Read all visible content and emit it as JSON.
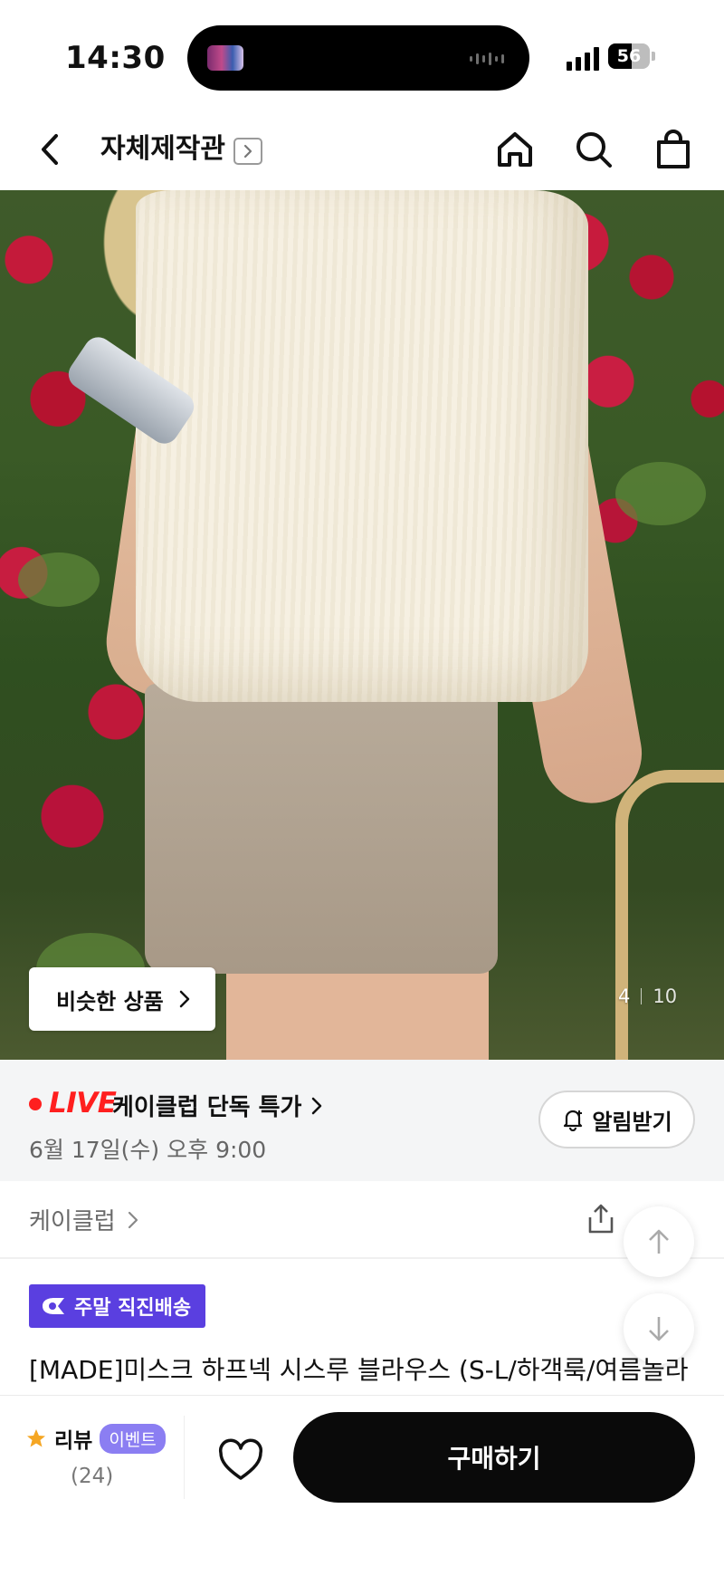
{
  "status_bar": {
    "time": "14:30",
    "battery_percent": "56",
    "battery_level": 0.56,
    "icons": [
      "signal-icon",
      "battery-icon"
    ]
  },
  "nav": {
    "title": "자체제작관",
    "icons": [
      "back-icon",
      "title-chevron-icon",
      "home-icon",
      "search-icon",
      "cart-icon"
    ]
  },
  "hero": {
    "similar_button_label": "비슷한 상품",
    "counter_current": "4",
    "counter_total": "10"
  },
  "live": {
    "tag": "LIVE",
    "title": "케이클럽 단독 특가",
    "date": "6월 17일(수) 오후 9:00",
    "alarm_label": "알림받기",
    "accent_color": "#ff1f1f"
  },
  "brand": {
    "name": "케이클럽",
    "icons": [
      "share-icon"
    ]
  },
  "scroll_buttons": [
    "scroll-up-icon",
    "scroll-down-icon"
  ],
  "product": {
    "delivery_badge": "주말 직진배송",
    "delivery_color": "#5a3fe0",
    "title": "[MADE]미스크 하프넥 시스루 블라우스 (S-L/하객룩/여름놀라"
  },
  "bottom_bar": {
    "review_label": "리뷰",
    "event_badge": "이벤트",
    "review_count": "(24)",
    "buy_label": "구매하기",
    "icons": [
      "star-icon",
      "heart-icon"
    ]
  }
}
